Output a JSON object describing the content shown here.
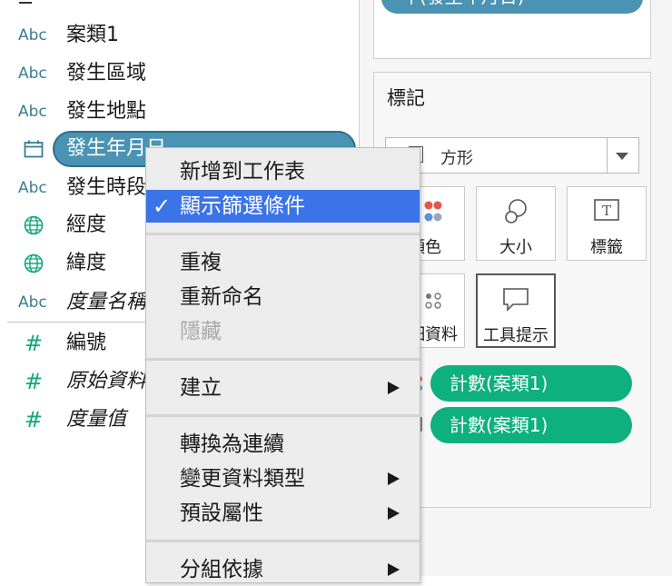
{
  "data_pane": {
    "fields": [
      {
        "type": "Abc",
        "name": "案類1"
      },
      {
        "type": "Abc",
        "name": "發生區域"
      },
      {
        "type": "Abc",
        "name": "發生地點"
      },
      {
        "type": "calendar-icon",
        "name": "發生年月日"
      },
      {
        "type": "Abc",
        "name": "發生時段"
      },
      {
        "type": "globe-icon",
        "name": "經度"
      },
      {
        "type": "globe-icon",
        "name": "緯度"
      },
      {
        "type": "Abc",
        "name": "度量名稱"
      },
      {
        "type": "#",
        "name": "編號"
      },
      {
        "type": "#",
        "name": "原始資料"
      },
      {
        "type": "#",
        "name": "度量值"
      }
    ]
  },
  "filters": {
    "pill_label": "年(發生年月日)"
  },
  "marks": {
    "title": "標記",
    "mark_type": "方形",
    "buttons": {
      "color": "顏色",
      "size": "大小",
      "label": "標籤",
      "detail": "詳細資料",
      "tooltip": "工具提示"
    },
    "pills": [
      "計數(案類1)",
      "計數(案類1)"
    ]
  },
  "context_menu": {
    "items": {
      "add_to_sheet": "新增到工作表",
      "show_filter": "顯示篩選條件",
      "duplicate": "重複",
      "rename": "重新命名",
      "hide": "隱藏",
      "create": "建立",
      "convert_continuous": "轉換為連續",
      "change_data_type": "變更資料類型",
      "default_properties": "預設屬性",
      "group_by": "分組依據"
    },
    "checkmark": "✓"
  },
  "colors": {
    "dimension_pill": "#4a93b2",
    "measure_pill": "#0eb07d",
    "menu_highlight": "#3b73e8"
  }
}
